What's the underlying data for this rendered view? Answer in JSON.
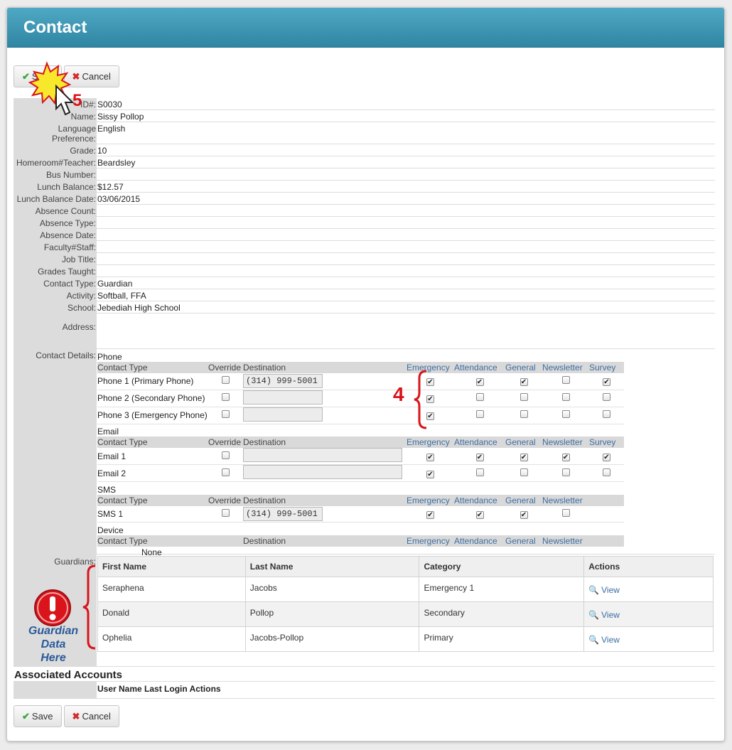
{
  "window": {
    "title": "Contact"
  },
  "buttons": {
    "save": "Save",
    "cancel": "Cancel"
  },
  "fields": [
    {
      "label": "ID#:",
      "value": "S0030"
    },
    {
      "label": "Name:",
      "value": "Sissy Pollop"
    },
    {
      "label": "Language Preference:",
      "value": "English"
    },
    {
      "label": "Grade:",
      "value": "10"
    },
    {
      "label": "Homeroom#Teacher:",
      "value": "Beardsley"
    },
    {
      "label": "Bus Number:",
      "value": ""
    },
    {
      "label": "Lunch Balance:",
      "value": "$12.57"
    },
    {
      "label": "Lunch Balance Date:",
      "value": "03/06/2015"
    },
    {
      "label": "Absence Count:",
      "value": ""
    },
    {
      "label": "Absence Type:",
      "value": ""
    },
    {
      "label": "Absence Date:",
      "value": ""
    },
    {
      "label": "Faculty#Staff:",
      "value": ""
    },
    {
      "label": "Job Title:",
      "value": ""
    },
    {
      "label": "Grades Taught:",
      "value": ""
    },
    {
      "label": "Contact Type:",
      "value": "Guardian"
    },
    {
      "label": "Activity:",
      "value": "Softball, FFA"
    },
    {
      "label": "School:",
      "value": "Jebediah High School"
    },
    {
      "label": "Address:",
      "value": ""
    }
  ],
  "contact_details": {
    "label": "Contact Details:",
    "headers": {
      "contact_type": "Contact Type",
      "override": "Override",
      "destination": "Destination",
      "emergency": "Emergency",
      "attendance": "Attendance",
      "general": "General",
      "newsletter": "Newsletter",
      "survey": "Survey"
    },
    "phone": {
      "title": "Phone",
      "rows": [
        {
          "name": "Phone 1 (Primary Phone)",
          "destination": "(314) 999-5001",
          "checks": [
            true,
            true,
            true,
            false,
            true
          ]
        },
        {
          "name": "Phone 2 (Secondary Phone)",
          "destination": "",
          "checks": [
            true,
            false,
            false,
            false,
            false
          ]
        },
        {
          "name": "Phone 3 (Emergency Phone)",
          "destination": "",
          "checks": [
            true,
            false,
            false,
            false,
            false
          ]
        }
      ]
    },
    "email": {
      "title": "Email",
      "rows": [
        {
          "name": "Email 1",
          "destination": "",
          "checks": [
            true,
            true,
            true,
            true,
            true
          ]
        },
        {
          "name": "Email 2",
          "destination": "",
          "checks": [
            true,
            false,
            false,
            false,
            false
          ]
        }
      ]
    },
    "sms": {
      "title": "SMS",
      "rows": [
        {
          "name": "SMS 1",
          "destination": "(314) 999-5001",
          "checks": [
            true,
            true,
            true,
            false
          ]
        }
      ]
    },
    "device": {
      "title": "Device",
      "none": "None"
    }
  },
  "guardians": {
    "label": "Guardians:",
    "headers": [
      "First Name",
      "Last Name",
      "Category",
      "Actions"
    ],
    "rows": [
      {
        "first": "Seraphena",
        "last": "Jacobs",
        "category": "Emergency 1",
        "action": "View"
      },
      {
        "first": "Donald",
        "last": "Pollop",
        "category": "Secondary",
        "action": "View"
      },
      {
        "first": "Ophelia",
        "last": "Jacobs-Pollop",
        "category": "Primary",
        "action": "View"
      }
    ]
  },
  "associated_accounts": {
    "title": "Associated Accounts",
    "headers": "User Name Last Login Actions"
  },
  "annotations": {
    "step5": "5",
    "step4": "4",
    "guardian_note": [
      "Guardian",
      "Data",
      "Here"
    ],
    "red": "#d9141b",
    "note_blue": "#2a5a9a"
  },
  "colors": {
    "title_bar": "#3a94b3",
    "label_bg": "#dcdcdc",
    "header_link": "#3d6ea3"
  }
}
